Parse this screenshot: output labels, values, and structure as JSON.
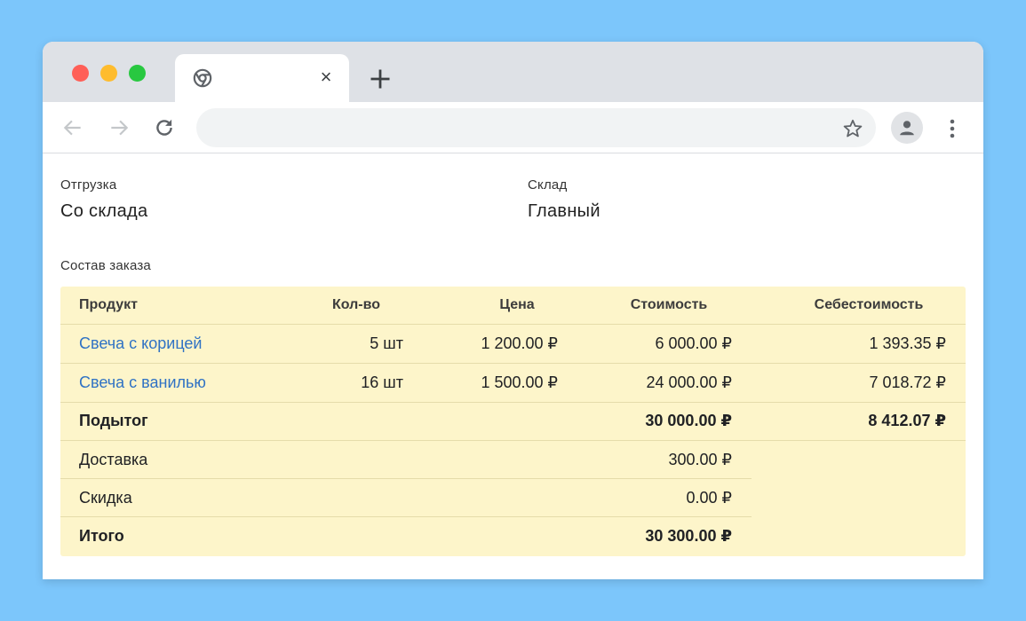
{
  "browser": {
    "tab_close": "×",
    "icons": {
      "tab_favicon": "chrome-icon",
      "new_tab": "plus-icon",
      "back": "arrow-left-icon",
      "forward": "arrow-right-icon",
      "reload": "reload-icon",
      "bookmark": "star-icon",
      "profile": "person-icon",
      "menu": "kebab-menu-icon"
    },
    "colors": {
      "background": "#7cc6fb",
      "tab_strip": "#dee1e6",
      "close_dot": "#ff5f57",
      "minimize_dot": "#febc2e",
      "maximize_dot": "#28c840"
    }
  },
  "shipment": {
    "label": "Отгрузка",
    "value": "Со склада"
  },
  "warehouse": {
    "label": "Склад",
    "value": "Главный"
  },
  "order": {
    "title": "Состав заказа",
    "columns": [
      "Продукт",
      "Кол-во",
      "Цена",
      "Стоимость",
      "Себестоимость"
    ],
    "rows": [
      {
        "product": "Свеча с корицей",
        "qty": "5 шт",
        "price": "1 200.00 ₽",
        "cost": "6 000.00 ₽",
        "prime_cost": "1 393.35 ₽"
      },
      {
        "product": "Свеча с ванилью",
        "qty": "16 шт",
        "price": "1 500.00 ₽",
        "cost": "24 000.00 ₽",
        "prime_cost": "7 018.72 ₽"
      }
    ],
    "subtotal": {
      "label": "Подытог",
      "cost": "30 000.00 ₽",
      "prime_cost": "8 412.07 ₽"
    },
    "delivery": {
      "label": "Доставка",
      "value": "300.00 ₽"
    },
    "discount": {
      "label": "Скидка",
      "value": "0.00 ₽"
    },
    "total": {
      "label": "Итого",
      "value": "30 300.00 ₽"
    },
    "colors": {
      "table_bg": "#fdf5ca",
      "link": "#2f72c4"
    }
  }
}
